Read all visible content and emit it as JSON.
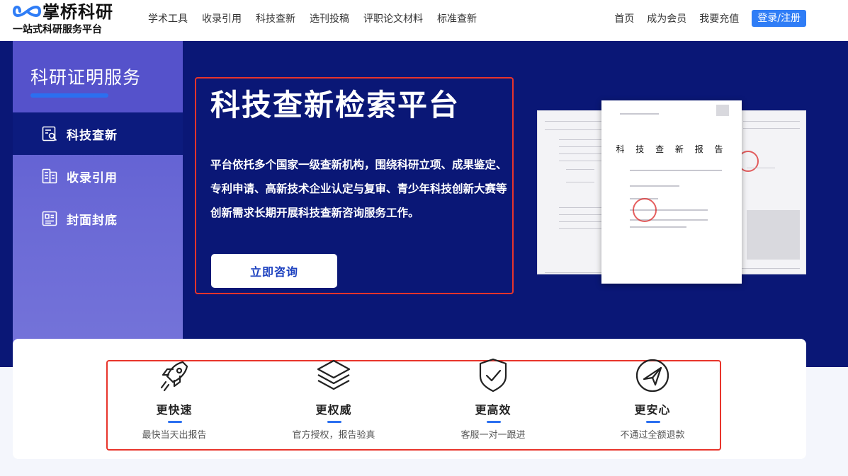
{
  "header": {
    "logo_name": "掌桥科研",
    "logo_slogan": "一站式科研服务平台",
    "nav": [
      "学术工具",
      "收录引用",
      "科技查新",
      "选刊投稿",
      "评职论文材料",
      "标准查新"
    ],
    "right_nav": [
      "首页",
      "成为会员",
      "我要充值"
    ],
    "login_label": "登录/注册"
  },
  "sidebar": {
    "title": "科研证明服务",
    "items": [
      {
        "label": "科技查新",
        "icon": "search-document-icon",
        "active": true
      },
      {
        "label": "收录引用",
        "icon": "citation-document-icon",
        "active": false
      },
      {
        "label": "封面封底",
        "icon": "cover-icon",
        "active": false
      }
    ]
  },
  "hero": {
    "title": "科技查新检索平台",
    "description": "平台依托多个国家一级查新机构，围绕科研立项、成果鉴定、专利申请、高新技术企业认定与复审、青少年科技创新大赛等创新需求长期开展科技查新咨询服务工作。",
    "button_label": "立即咨询",
    "doc_title": "科 技 查 新 报 告"
  },
  "features": [
    {
      "title": "更快速",
      "subtitle": "最快当天出报告",
      "icon": "rocket-icon"
    },
    {
      "title": "更权威",
      "subtitle": "官方授权，报告验真",
      "icon": "layers-icon"
    },
    {
      "title": "更高效",
      "subtitle": "客服一对一跟进",
      "icon": "shield-check-icon"
    },
    {
      "title": "更安心",
      "subtitle": "不通过全额退款",
      "icon": "send-icon"
    }
  ],
  "colors": {
    "hero_bg": "#0a1776",
    "sidebar_bg": "#5a58cf",
    "accent_blue": "#2f7df6",
    "highlight_red": "#e8342b"
  }
}
